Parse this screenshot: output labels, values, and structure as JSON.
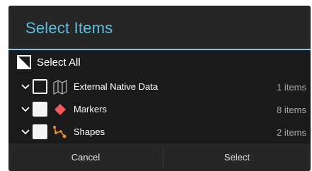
{
  "dialog": {
    "title": "Select Items",
    "select_all_label": "Select All",
    "items": [
      {
        "label": "External Native Data",
        "count": "1 items",
        "checked": false,
        "icon": "map-icon"
      },
      {
        "label": "Markers",
        "count": "8 items",
        "checked": false,
        "icon": "marker-diamond-icon"
      },
      {
        "label": "Shapes",
        "count": "2 items",
        "checked": false,
        "icon": "shapes-icon"
      }
    ],
    "buttons": {
      "cancel_label": "Cancel",
      "select_label": "Select"
    }
  },
  "colors": {
    "accent": "#5dbfe0",
    "divider": "#7fc4dc",
    "marker": "#ef5a5a",
    "shapes": "#f08a2c"
  }
}
